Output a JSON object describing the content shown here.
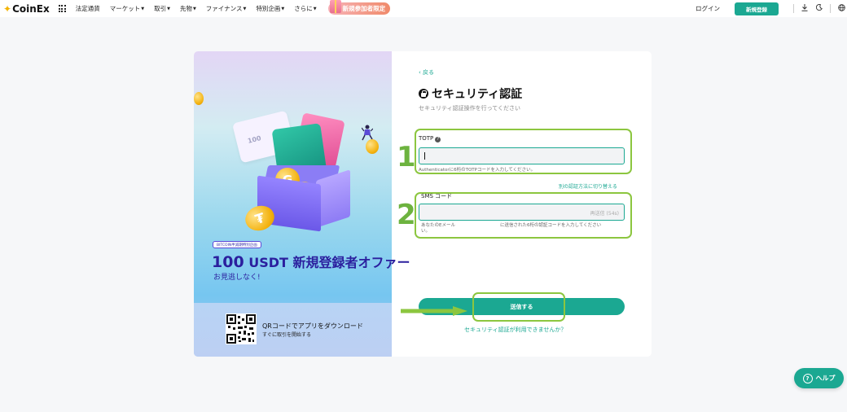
{
  "nav": {
    "logo": "CoinEx",
    "items": [
      "法定通貨",
      "マーケット",
      "取引",
      "先物",
      "ファイナンス",
      "特別企画",
      "さらに"
    ],
    "dropdown_flags": [
      false,
      true,
      true,
      true,
      true,
      true,
      true
    ],
    "promo": "新規参加者限定",
    "login": "ログイン",
    "signup": "新規登録"
  },
  "banner": {
    "tag": "BITCOIN半減期特別企画",
    "headline_amount": "100",
    "headline_rest": "USDT 新規登録者オファー",
    "subline": "お見逃しなく!",
    "ticket_text": "100",
    "qr_title": "QRコードでアプリをダウンロード",
    "qr_sub": "すぐに取引を開始する"
  },
  "form": {
    "back": "戻る",
    "title": "セキュリティ認証",
    "subtitle": "セキュリティ認証操作を行ってください",
    "totp_label": "TOTP",
    "totp_value": "",
    "totp_hint": "Authenticatorに6桁のTOTPコードを入力してください。",
    "switch_method": "別の認証方法に切り替える",
    "sms_label": "SMS コード",
    "sms_value": "",
    "resend": "再送信 (54s)",
    "sms_hint_a": "あなたのEメール",
    "sms_hint_b": "に送信された6桁の認証コードを入力してください",
    "sms_hint_c": "い。",
    "submit": "送信する",
    "unavailable": "セキュリティ認証が利用できませんか？"
  },
  "annotations": {
    "step1": "1",
    "step2": "2",
    "color": "#8cc63f"
  },
  "help": {
    "label": "ヘルプ"
  },
  "colors": {
    "brand": "#1ba892",
    "headline": "#2b1f9e"
  }
}
